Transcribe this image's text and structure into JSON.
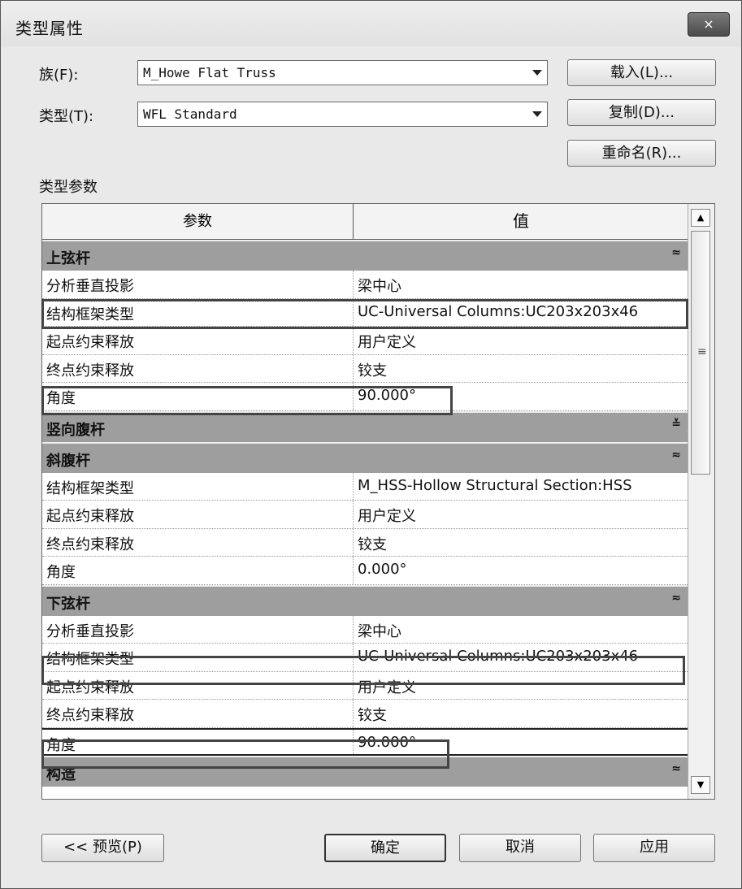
{
  "window": {
    "title": "类型属性",
    "close_icon": "×"
  },
  "family": {
    "label": "族(F):",
    "value": "M_Howe Flat Truss"
  },
  "type": {
    "label": "类型(T):",
    "value": "WFL Standard"
  },
  "buttons": {
    "load": "载入(L)...",
    "duplicate": "复制(D)...",
    "rename": "重命名(R)..."
  },
  "type_params_label": "类型参数",
  "table": {
    "headers": {
      "param": "参数",
      "value": "值"
    },
    "groups": {
      "top_chord": {
        "title": "上弦杆",
        "icon": "≈",
        "rows": [
          {
            "name": "分析垂直投影",
            "value": "梁中心"
          },
          {
            "name": "结构框架类型",
            "value": "UC-Universal Columns:UC203x203x46"
          },
          {
            "name": "起点约束释放",
            "value": "用户定义"
          },
          {
            "name": "终点约束释放",
            "value": "铰支"
          },
          {
            "name": "角度",
            "value": "90.000°"
          }
        ]
      },
      "vertical_web": {
        "title": "竖向腹杆",
        "icon": "≚"
      },
      "diagonal_web": {
        "title": "斜腹杆",
        "icon": "≈",
        "rows": [
          {
            "name": "结构框架类型",
            "value": "M_HSS-Hollow Structural Section:HSS"
          },
          {
            "name": "起点约束释放",
            "value": "用户定义"
          },
          {
            "name": "终点约束释放",
            "value": "铰支"
          },
          {
            "name": "角度",
            "value": "0.000°"
          }
        ]
      },
      "bottom_chord": {
        "title": "下弦杆",
        "icon": "≈",
        "rows": [
          {
            "name": "分析垂直投影",
            "value": "梁中心"
          },
          {
            "name": "结构框架类型",
            "value": "UC-Universal Columns:UC203x203x46"
          },
          {
            "name": "起点约束释放",
            "value": "用户定义"
          },
          {
            "name": "终点约束释放",
            "value": "铰支"
          },
          {
            "name": "角度",
            "value": "90.000°"
          }
        ]
      },
      "construction": {
        "title": "构造",
        "icon": "≈"
      }
    }
  },
  "footer": {
    "preview": "<< 预览(P)",
    "ok": "确定",
    "cancel": "取消",
    "apply": "应用"
  }
}
